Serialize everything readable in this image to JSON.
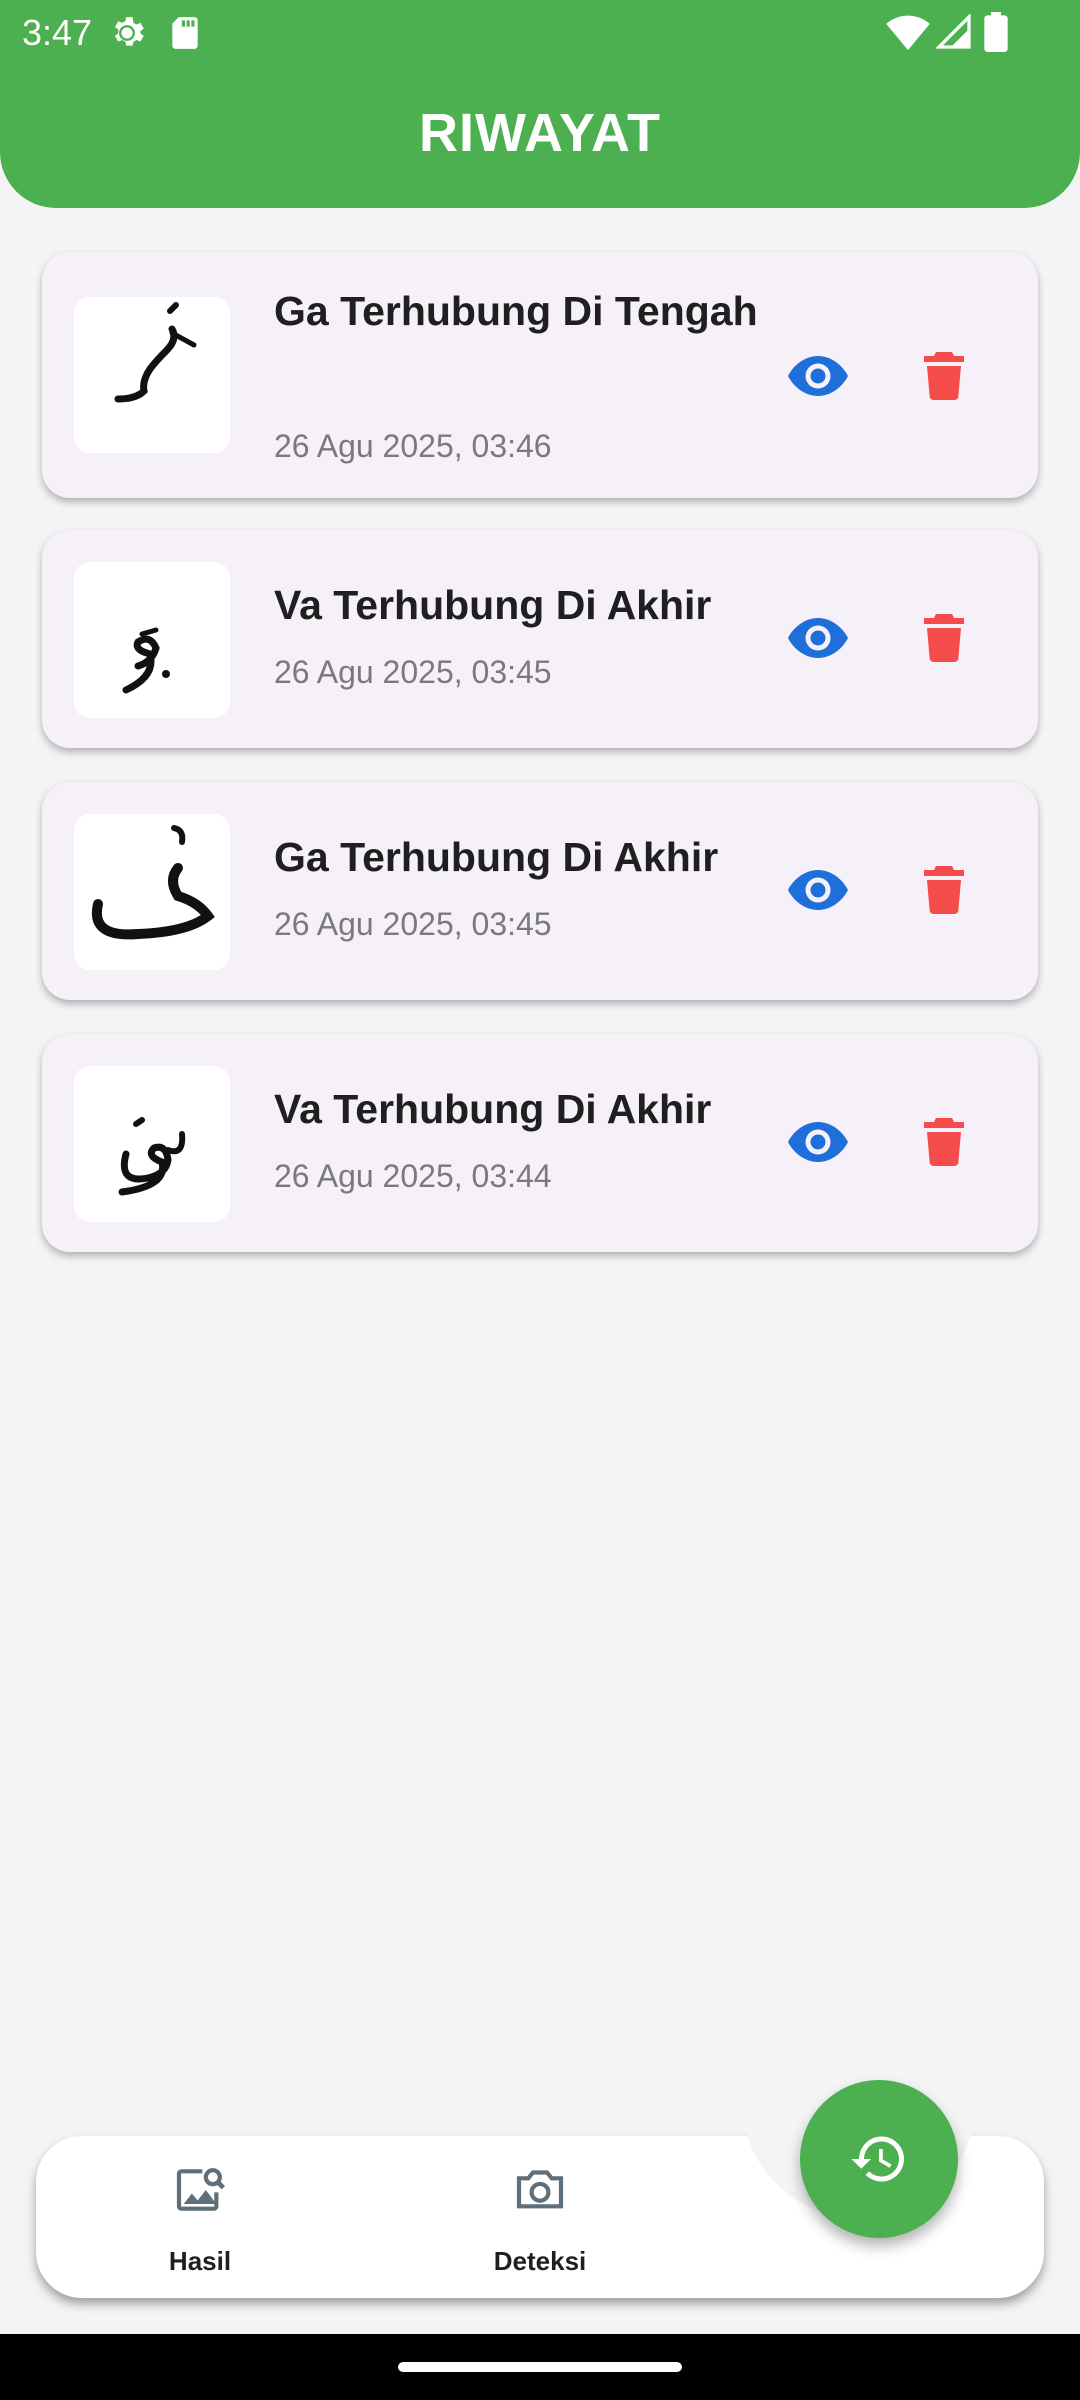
{
  "status_bar": {
    "time": "3:47"
  },
  "app_bar": {
    "title": "RIWAYAT"
  },
  "history": [
    {
      "title": "Ga Terhubung Di Tengah",
      "date": "26 Agu 2025, 03:46",
      "thumbnail": "ghain-medial-glyph"
    },
    {
      "title": "Va Terhubung Di Akhir",
      "date": "26 Agu 2025, 03:45",
      "thumbnail": "va-final-glyph"
    },
    {
      "title": "Ga Terhubung Di Akhir",
      "date": "26 Agu 2025, 03:45",
      "thumbnail": "ghain-final-glyph"
    },
    {
      "title": "Va Terhubung Di Akhir",
      "date": "26 Agu 2025, 03:44",
      "thumbnail": "va-final-glyph-2"
    }
  ],
  "bottom_nav": {
    "items": [
      {
        "label": "Hasil",
        "icon": "image-search-icon"
      },
      {
        "label": "Deteksi",
        "icon": "camera-icon"
      }
    ],
    "fab_icon": "history-icon"
  },
  "colors": {
    "primary": "#4caf50",
    "view": "#1e6fd9",
    "delete": "#f44b4b",
    "card": "#f6f1f8"
  }
}
